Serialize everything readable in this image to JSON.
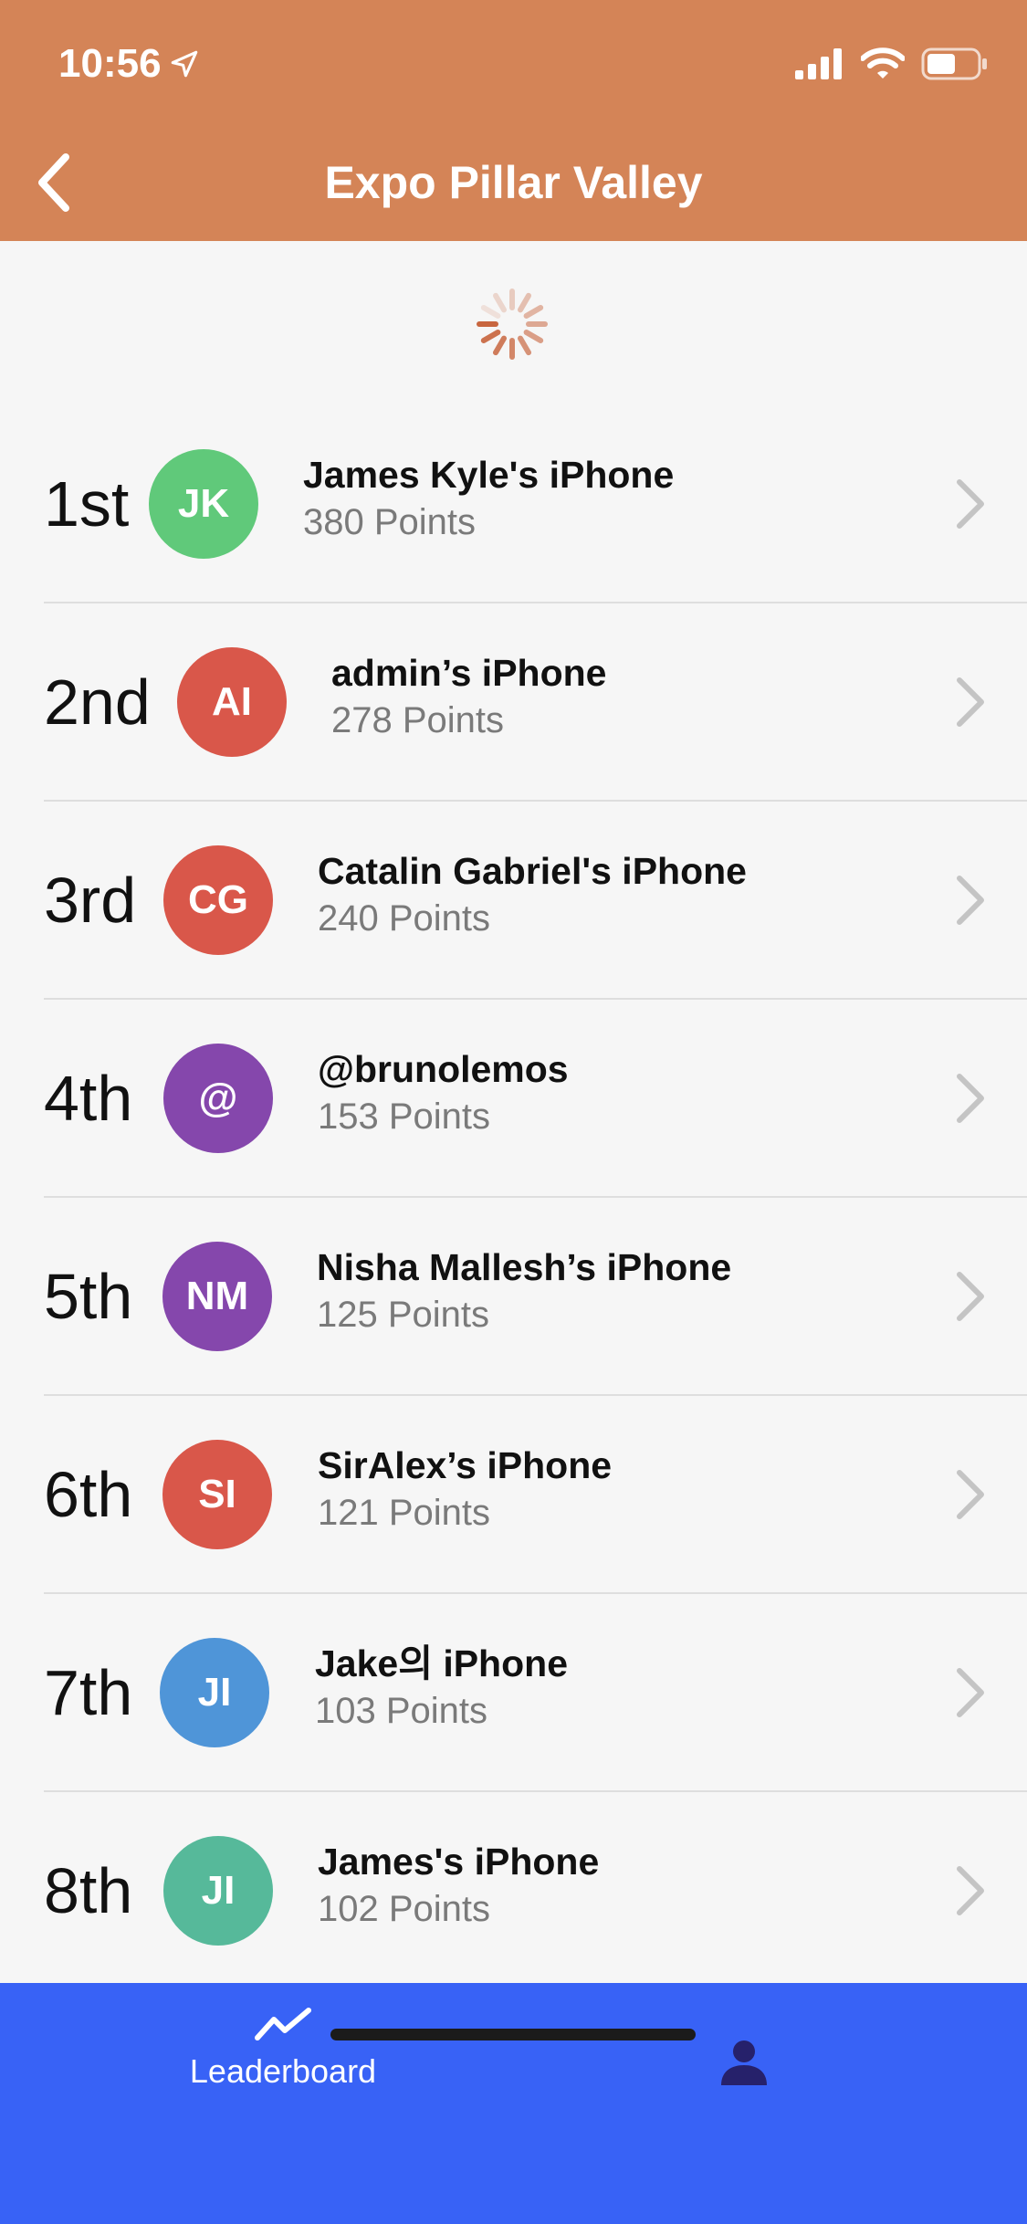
{
  "status_bar": {
    "time": "10:56",
    "icons": [
      "location-arrow-icon",
      "cellular-signal-icon",
      "wifi-icon",
      "battery-icon"
    ]
  },
  "nav": {
    "title": "Expo Pillar Valley",
    "back_icon": "chevron-left-icon"
  },
  "leaderboard": {
    "rows": [
      {
        "rank": "1st",
        "initials": "JK",
        "name": "James Kyle's iPhone",
        "points": "380 Points",
        "color": "#60c97a"
      },
      {
        "rank": "2nd",
        "initials": "AI",
        "name": "admin’s iPhone",
        "points": "278 Points",
        "color": "#d9574a"
      },
      {
        "rank": "3rd",
        "initials": "CG",
        "name": "Catalin Gabriel's iPhone",
        "points": "240 Points",
        "color": "#d9574a"
      },
      {
        "rank": "4th",
        "initials": "@",
        "name": "@brunolemos",
        "points": "153 Points",
        "color": "#8547ac"
      },
      {
        "rank": "5th",
        "initials": "NM",
        "name": "Nisha Mallesh’s iPhone",
        "points": "125 Points",
        "color": "#8547ac"
      },
      {
        "rank": "6th",
        "initials": "SI",
        "name": "SirAlex’s iPhone",
        "points": "121 Points",
        "color": "#d9574a"
      },
      {
        "rank": "7th",
        "initials": "JI",
        "name": "Jake의 iPhone",
        "points": "103 Points",
        "color": "#4f95d8"
      },
      {
        "rank": "8th",
        "initials": "JI",
        "name": "James's iPhone",
        "points": "102 Points",
        "color": "#56b99a"
      }
    ]
  },
  "tabbar": {
    "leaderboard_label": "Leaderboard",
    "leaderboard_icon": "trend-line-icon",
    "profile_icon": "person-icon"
  },
  "colors": {
    "header": "#d48457",
    "tabbar": "#3862f6",
    "background": "#f6f6f6"
  }
}
